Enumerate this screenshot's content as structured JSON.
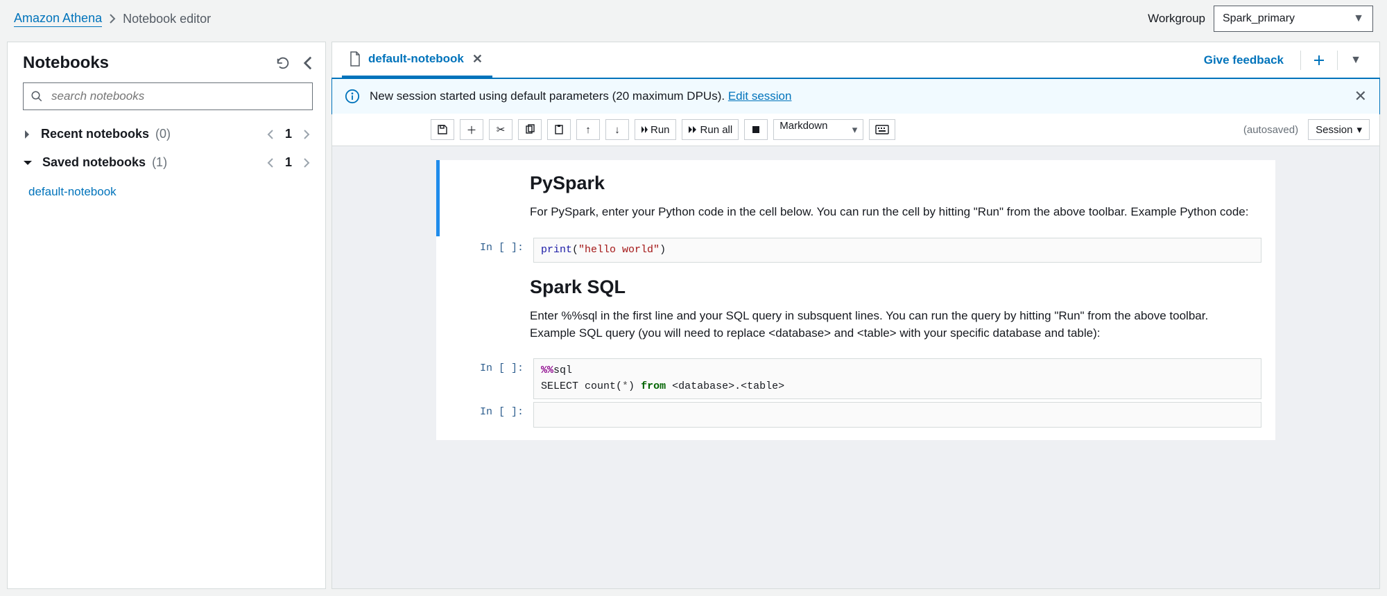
{
  "breadcrumb": {
    "service": "Amazon Athena",
    "current": "Notebook editor"
  },
  "workgroup": {
    "label": "Workgroup",
    "value": "Spark_primary"
  },
  "sidebar": {
    "title": "Notebooks",
    "search_placeholder": "search notebooks",
    "groups": [
      {
        "name": "Recent notebooks",
        "count": "(0)",
        "page": "1",
        "expanded": false
      },
      {
        "name": "Saved notebooks",
        "count": "(1)",
        "page": "1",
        "expanded": true
      }
    ],
    "saved_items": [
      {
        "label": "default-notebook"
      }
    ]
  },
  "tabs": {
    "active": {
      "label": "default-notebook"
    },
    "feedback": "Give feedback"
  },
  "banner": {
    "text": "New session started using default parameters (20 maximum DPUs). ",
    "link": "Edit session"
  },
  "nbToolbar": {
    "run": "Run",
    "run_all": "Run all",
    "cell_type": "Markdown",
    "autosaved": "(autosaved)",
    "session": "Session"
  },
  "notebook": {
    "md1_title": "PySpark",
    "md1_body": "For PySpark, enter your Python code in the cell below. You can run the cell by hitting \"Run\" from the above toolbar. Example Python code:",
    "code1_prompt": "In [ ]:",
    "code1_fn": "print",
    "code1_paren_open": "(",
    "code1_str": "\"hello world\"",
    "code1_paren_close": ")",
    "md2_title": "Spark SQL",
    "md2_body": "Enter %%sql in the first line and your SQL query in subsquent lines. You can run the query by hitting \"Run\" from the above toolbar. Example SQL query (you will need to replace <database> and <table> with your specific database and table):",
    "code2_prompt": "In [ ]:",
    "code2_l1_magic": "%%",
    "code2_l1_sql": "sql",
    "code2_l2_a": "SELECT count(",
    "code2_l2_star": "*",
    "code2_l2_b": ") ",
    "code2_l2_from": "from",
    "code2_l2_c": " <database>.<table>",
    "code3_prompt": "In [ ]:"
  }
}
